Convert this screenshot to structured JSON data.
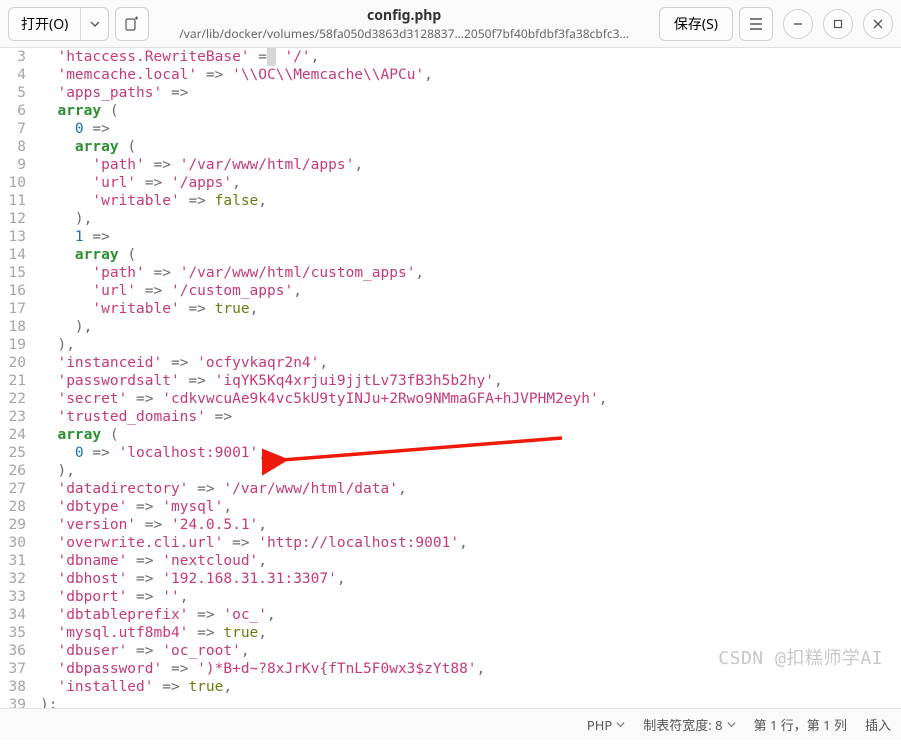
{
  "header": {
    "open_label": "打开(O)",
    "save_label": "保存(S)",
    "title": "config.php",
    "subtitle": "/var/lib/docker/volumes/58fa050d3863d3128837…2050f7bf40bfdbf3fa38cbfc3…"
  },
  "code": {
    "lines": [
      {
        "n": 3,
        "html": "  <span class='s'>'htaccess.RewriteBase'</span> <span class='p'>=</span><span class='cursor-box'>&nbsp;</span> <span class='s'>'/'</span><span class='p'>,</span>"
      },
      {
        "n": 4,
        "html": "  <span class='s'>'memcache.local'</span> <span class='p'>=&gt;</span> <span class='s'>'\\\\OC\\\\Memcache\\\\APCu'</span><span class='p'>,</span>"
      },
      {
        "n": 5,
        "html": "  <span class='s'>'apps_paths'</span> <span class='p'>=&gt;</span>"
      },
      {
        "n": 6,
        "html": "  <span class='k'>array</span> <span class='p'>(</span>"
      },
      {
        "n": 7,
        "html": "    <span class='n'>0</span> <span class='p'>=&gt;</span>"
      },
      {
        "n": 8,
        "html": "    <span class='k'>array</span> <span class='p'>(</span>"
      },
      {
        "n": 9,
        "html": "      <span class='s'>'path'</span> <span class='p'>=&gt;</span> <span class='s'>'/var/www/html/apps'</span><span class='p'>,</span>"
      },
      {
        "n": 10,
        "html": "      <span class='s'>'url'</span> <span class='p'>=&gt;</span> <span class='s'>'/apps'</span><span class='p'>,</span>"
      },
      {
        "n": 11,
        "html": "      <span class='s'>'writable'</span> <span class='p'>=&gt;</span> <span class='b'>false</span><span class='p'>,</span>"
      },
      {
        "n": 12,
        "html": "    <span class='p'>),</span>"
      },
      {
        "n": 13,
        "html": "    <span class='n'>1</span> <span class='p'>=&gt;</span>"
      },
      {
        "n": 14,
        "html": "    <span class='k'>array</span> <span class='p'>(</span>"
      },
      {
        "n": 15,
        "html": "      <span class='s'>'path'</span> <span class='p'>=&gt;</span> <span class='s'>'/var/www/html/custom_apps'</span><span class='p'>,</span>"
      },
      {
        "n": 16,
        "html": "      <span class='s'>'url'</span> <span class='p'>=&gt;</span> <span class='s'>'/custom_apps'</span><span class='p'>,</span>"
      },
      {
        "n": 17,
        "html": "      <span class='s'>'writable'</span> <span class='p'>=&gt;</span> <span class='b'>true</span><span class='p'>,</span>"
      },
      {
        "n": 18,
        "html": "    <span class='p'>),</span>"
      },
      {
        "n": 19,
        "html": "  <span class='p'>),</span>"
      },
      {
        "n": 20,
        "html": "  <span class='s'>'instanceid'</span> <span class='p'>=&gt;</span> <span class='s'>'ocfyvkaqr2n4'</span><span class='p'>,</span>"
      },
      {
        "n": 21,
        "html": "  <span class='s'>'passwordsalt'</span> <span class='p'>=&gt;</span> <span class='s'>'iqYK5Kq4xrjui9jjtLv73fB3h5b2hy'</span><span class='p'>,</span>"
      },
      {
        "n": 22,
        "html": "  <span class='s'>'secret'</span> <span class='p'>=&gt;</span> <span class='s'>'cdkvwcuAe9k4vc5kU9tyINJu+2Rwo9NMmaGFA+hJVPHM2eyh'</span><span class='p'>,</span>"
      },
      {
        "n": 23,
        "html": "  <span class='s'>'trusted_domains'</span> <span class='p'>=&gt;</span>"
      },
      {
        "n": 24,
        "html": "  <span class='k'>array</span> <span class='p'>(</span>"
      },
      {
        "n": 25,
        "html": "    <span class='n'>0</span> <span class='p'>=&gt;</span> <span class='s'>'localhost:9001'</span><span class='p'>,</span>"
      },
      {
        "n": 26,
        "html": "  <span class='p'>),</span>"
      },
      {
        "n": 27,
        "html": "  <span class='s'>'datadirectory'</span> <span class='p'>=&gt;</span> <span class='s'>'/var/www/html/data'</span><span class='p'>,</span>"
      },
      {
        "n": 28,
        "html": "  <span class='s'>'dbtype'</span> <span class='p'>=&gt;</span> <span class='s'>'mysql'</span><span class='p'>,</span>"
      },
      {
        "n": 29,
        "html": "  <span class='s'>'version'</span> <span class='p'>=&gt;</span> <span class='s'>'24.0.5.1'</span><span class='p'>,</span>"
      },
      {
        "n": 30,
        "html": "  <span class='s'>'overwrite.cli.url'</span> <span class='p'>=&gt;</span> <span class='s'>'http://localhost:9001'</span><span class='p'>,</span>"
      },
      {
        "n": 31,
        "html": "  <span class='s'>'dbname'</span> <span class='p'>=&gt;</span> <span class='s'>'nextcloud'</span><span class='p'>,</span>"
      },
      {
        "n": 32,
        "html": "  <span class='s'>'dbhost'</span> <span class='p'>=&gt;</span> <span class='s'>'192.168.31.31:3307'</span><span class='p'>,</span>"
      },
      {
        "n": 33,
        "html": "  <span class='s'>'dbport'</span> <span class='p'>=&gt;</span> <span class='s'>''</span><span class='p'>,</span>"
      },
      {
        "n": 34,
        "html": "  <span class='s'>'dbtableprefix'</span> <span class='p'>=&gt;</span> <span class='s'>'oc_'</span><span class='p'>,</span>"
      },
      {
        "n": 35,
        "html": "  <span class='s'>'mysql.utf8mb4'</span> <span class='p'>=&gt;</span> <span class='b'>true</span><span class='p'>,</span>"
      },
      {
        "n": 36,
        "html": "  <span class='s'>'dbuser'</span> <span class='p'>=&gt;</span> <span class='s'>'oc_root'</span><span class='p'>,</span>"
      },
      {
        "n": 37,
        "html": "  <span class='s'>'dbpassword'</span> <span class='p'>=&gt;</span> <span class='s'>')*B+d~?8xJrKv{fTnL5F0wx3$zYt88'</span><span class='p'>,</span>"
      },
      {
        "n": 38,
        "html": "  <span class='s'>'installed'</span> <span class='p'>=&gt;</span> <span class='b'>true</span><span class='p'>,</span>"
      },
      {
        "n": 39,
        "html": "<span class='p'>);</span>"
      }
    ]
  },
  "status": {
    "language": "PHP",
    "tab_label": "制表符宽度: 8",
    "position": "第 1 行，第 1 列",
    "mode": "插入"
  },
  "watermark": "CSDN @扣糕师学AI"
}
